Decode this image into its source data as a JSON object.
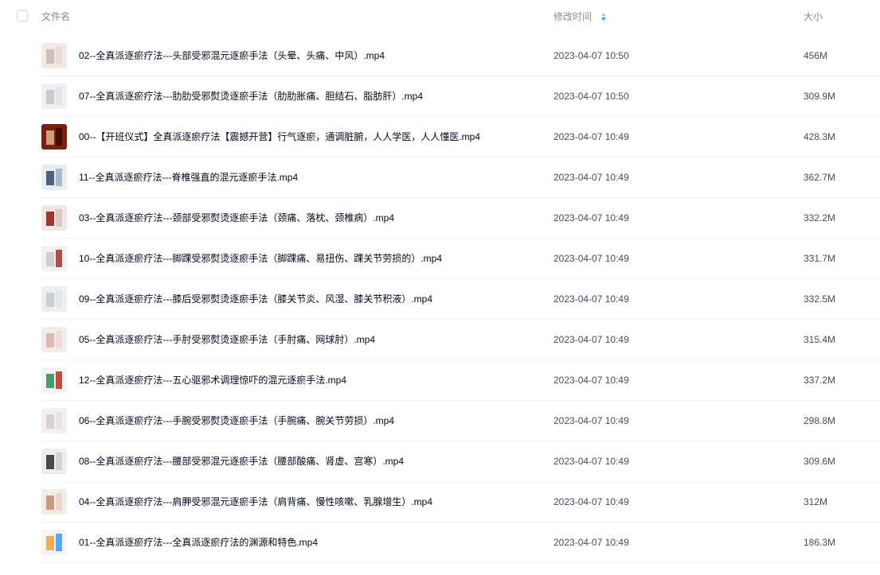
{
  "header": {
    "name_label": "文件名",
    "time_label": "修改时间",
    "size_label": "大小"
  },
  "files": [
    {
      "name": "02--全真派逐瘀疗法---头部受邪混元逐瘀手法（头晕、头痛、中风）.mp4",
      "time": "2023-04-07 10:50",
      "size": "456M"
    },
    {
      "name": "07--全真派逐瘀疗法---肋肋受邪熨烫逐瘀手法（肋肋胀痛、胆结石、脂肪肝）.mp4",
      "time": "2023-04-07 10:50",
      "size": "309.9M"
    },
    {
      "name": "00--【开班仪式】全真派逐瘀疗法【震撼开营】行气逐瘀，通调脏腑，人人学医，人人懂医.mp4",
      "time": "2023-04-07 10:49",
      "size": "428.3M"
    },
    {
      "name": "11--全真派逐瘀疗法---脊椎强直的混元逐瘀手法.mp4",
      "time": "2023-04-07 10:49",
      "size": "362.7M"
    },
    {
      "name": "03--全真派逐瘀疗法---颈部受邪熨烫逐瘀手法（颈痛、落枕、颈椎病）.mp4",
      "time": "2023-04-07 10:49",
      "size": "332.2M"
    },
    {
      "name": "10--全真派逐瘀疗法---脚踝受邪熨烫逐瘀手法（脚踝痛、易扭伤、踝关节劳损的）.mp4",
      "time": "2023-04-07 10:49",
      "size": "331.7M"
    },
    {
      "name": "09--全真派逐瘀疗法---膝后受邪熨烫逐瘀手法（膝关节炎、风湿、膝关节积液）.mp4",
      "time": "2023-04-07 10:49",
      "size": "332.5M"
    },
    {
      "name": "05--全真派逐瘀疗法---手肘受邪熨烫逐瘀手法（手肘痛、网球肘）.mp4",
      "time": "2023-04-07 10:49",
      "size": "315.4M"
    },
    {
      "name": "12--全真派逐瘀疗法---五心驱邪术调理惊吓的混元逐瘀手法.mp4",
      "time": "2023-04-07 10:49",
      "size": "337.2M"
    },
    {
      "name": "06--全真派逐瘀疗法---手腕受邪熨烫逐瘀手法（手腕痛、腕关节劳损）.mp4",
      "time": "2023-04-07 10:49",
      "size": "298.8M"
    },
    {
      "name": "08--全真派逐瘀疗法---腰部受邪混元逐瘀手法（腰部酸痛、肾虚、宫寒）.mp4",
      "time": "2023-04-07 10:49",
      "size": "309.6M"
    },
    {
      "name": "04--全真派逐瘀疗法---肩胛受邪混元逐瘀手法（肩背痛、慢性咳嗽、乳腺增生）.mp4",
      "time": "2023-04-07 10:49",
      "size": "312M"
    },
    {
      "name": "01--全真派逐瘀疗法---全真派逐瘀疗法的渊源和特色.mp4",
      "time": "2023-04-07 10:49",
      "size": "186.3M"
    }
  ],
  "icons": {
    "sort": "sort-icon",
    "thumbnail": "video-thumbnail"
  },
  "colors": {
    "header_text": "#878c9c",
    "body_text": "#03081a",
    "meta_text": "#454d5a",
    "divider": "#f1f2f4",
    "sort_accent": "#06a7ff"
  }
}
